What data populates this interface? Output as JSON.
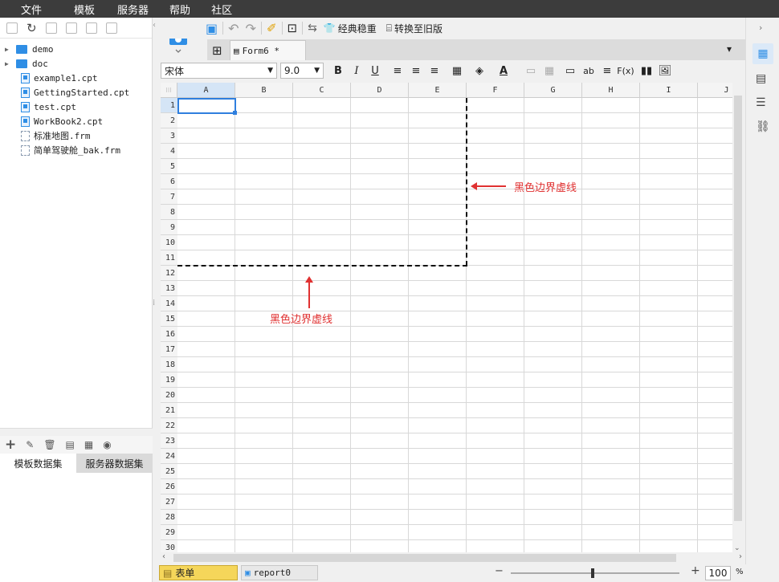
{
  "menu": [
    "文件",
    "模板",
    "服务器",
    "帮助",
    "社区"
  ],
  "file_tree": [
    {
      "name": "demo",
      "type": "folder"
    },
    {
      "name": "doc",
      "type": "folder"
    },
    {
      "name": "example1.cpt",
      "type": "cpt"
    },
    {
      "name": "GettingStarted.cpt",
      "type": "cpt"
    },
    {
      "name": "test.cpt",
      "type": "cpt"
    },
    {
      "name": "WorkBook2.cpt",
      "type": "cpt"
    },
    {
      "name": "标准地图.frm",
      "type": "frm"
    },
    {
      "name": "简单驾驶舱_bak.frm",
      "type": "frm"
    }
  ],
  "dataset_tabs": [
    "模板数据集",
    "服务器数据集"
  ],
  "toolbar": {
    "classic_label": "经典稳重",
    "convert_label": "转换至旧版"
  },
  "tab": {
    "label": "Form6 *"
  },
  "format": {
    "font": "宋体",
    "size": "9.0"
  },
  "columns": [
    "A",
    "B",
    "C",
    "D",
    "E",
    "F",
    "G",
    "H",
    "I",
    "J"
  ],
  "rows": [
    "1",
    "2",
    "3",
    "4",
    "5",
    "6",
    "7",
    "8",
    "9",
    "10",
    "11",
    "12",
    "13",
    "14",
    "15",
    "16",
    "17",
    "18",
    "19",
    "20",
    "21",
    "22",
    "23",
    "24",
    "25",
    "26",
    "27",
    "28",
    "29",
    "30"
  ],
  "annotations": {
    "right": "黑色边界虚线",
    "bottom": "黑色边界虚线"
  },
  "sheet_tabs": [
    "表单",
    "report0"
  ],
  "zoom": "100",
  "zoom_unit": "%"
}
